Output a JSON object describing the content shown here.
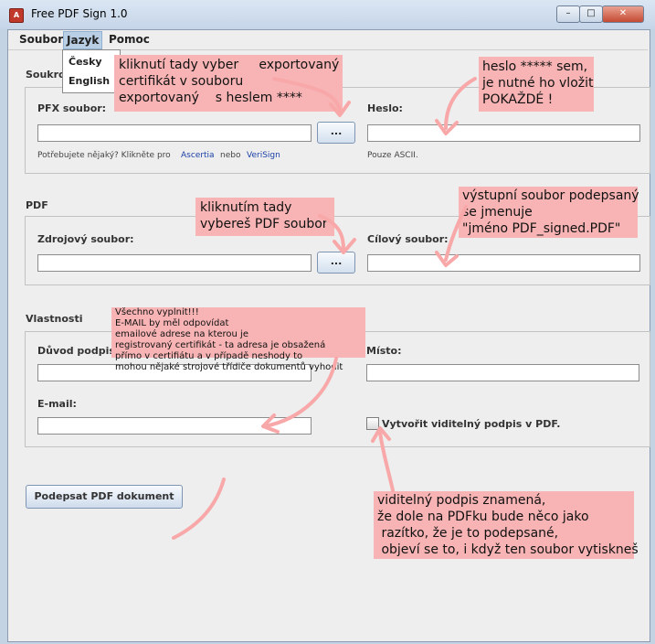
{
  "window": {
    "title": "Free PDF Sign 1.0",
    "app_icon": "pdf-icon"
  },
  "controls": {
    "minimize": "–",
    "maximize": "□",
    "close": "✕"
  },
  "menu": {
    "file": "Soubor",
    "language": "Jazyk",
    "help": "Pomoc",
    "language_items": [
      "Česky",
      "English"
    ]
  },
  "sections": {
    "certificate": {
      "label": "Soukro",
      "pfx_label": "PFX soubor:",
      "pfx_value": "",
      "browse": "...",
      "need_text": "Potřebujete nějaký? Klikněte pro",
      "link_ascertia": "Ascertia",
      "or_text": "nebo",
      "link_verisign": "VeriSign",
      "password_label": "Heslo:",
      "password_value": "",
      "ascii_note": "Pouze ASCII."
    },
    "pdf": {
      "label": "PDF",
      "source_label": "Zdrojový soubor:",
      "source_value": "",
      "browse": "...",
      "target_label": "Cílový soubor:",
      "target_value": ""
    },
    "properties": {
      "label": "Vlastnosti",
      "reason_label": "Důvod podpisu",
      "reason_value": "",
      "place_label": "Místo:",
      "place_value": "",
      "email_label": "E-mail:",
      "email_value": "",
      "visible_sig_label": "Vytvořit viditelný podpis v PDF.",
      "visible_sig_checked": false
    }
  },
  "sign_button": "Podepsat PDF dokument",
  "annotations": {
    "cert": "kliknutí tady vyber     exportovaný\ncertifikát v souboru\nexportovaný    s heslem ****",
    "password": "heslo ***** sem,\nje nutné ho vložit\nPOKAŽDÉ !",
    "source": "kliknutím tady\nvybereš PDF soubor",
    "target": "výstupní soubor podepsaný\nse jmenuje\n\"jméno PDF_signed.PDF\"",
    "fill_all": "Všechno vyplnit!!!\nE-MAIL by měl odpovídat\nemailové adrese na kterou je\nregistrovaný certifikát - ta adresa je obsažená\npřímo v certifiátu a v případě neshody to\nmohou nějaké strojové třídiče dokumentů vyhodit",
    "visible": "viditelný podpis znamená,\nže dole na PDFku bude něco jako\n razítko, že je to podepsané,\n objeví se to, i když ten soubor vytiskneš"
  },
  "colors": {
    "note_bg": "#f8b4b4",
    "link": "#1a3fa6",
    "frame": "#c4d3e4"
  }
}
